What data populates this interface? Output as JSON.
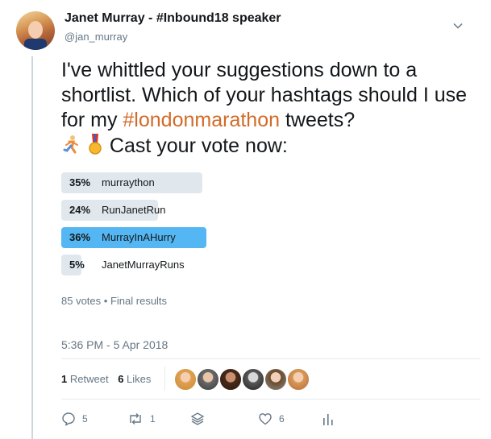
{
  "header": {
    "display_name": "Janet Murray - #Inbound18 speaker",
    "handle": "@jan_murray",
    "menu_icon": "chevron-down-icon"
  },
  "tweet": {
    "text_before": "I've whittled your suggestions down to a shortlist. Which of your hashtags should I use for my ",
    "hashtag": "#londonmarathon",
    "text_after": " tweets?",
    "cta": "Cast your vote now:",
    "emojis": [
      "runner-emoji",
      "medal-emoji"
    ],
    "hashtag_color": "#d26b28"
  },
  "poll": {
    "options": [
      {
        "percent": "35%",
        "label": "murraython",
        "value": 35,
        "winner": false
      },
      {
        "percent": "24%",
        "label": "RunJanetRun",
        "value": 24,
        "winner": false
      },
      {
        "percent": "36%",
        "label": "MurrayInAHurry",
        "value": 36,
        "winner": true
      },
      {
        "percent": "5%",
        "label": "JanetMurrayRuns",
        "value": 5,
        "winner": false
      }
    ],
    "votes": "85 votes",
    "separator": "•",
    "status": "Final results",
    "winner_color": "#54b6f2",
    "bar_color": "#e1e8ed"
  },
  "timestamp": "5:36 PM - 5 Apr 2018",
  "stats": {
    "retweet_count": "1",
    "retweet_label": "Retweet",
    "like_count": "6",
    "like_label": "Likes"
  },
  "likers": [
    "avatar-1",
    "avatar-2",
    "avatar-3",
    "avatar-4",
    "avatar-5",
    "avatar-6"
  ],
  "actions": {
    "reply_count": "5",
    "retweet_count": "1",
    "like_count": "6"
  }
}
